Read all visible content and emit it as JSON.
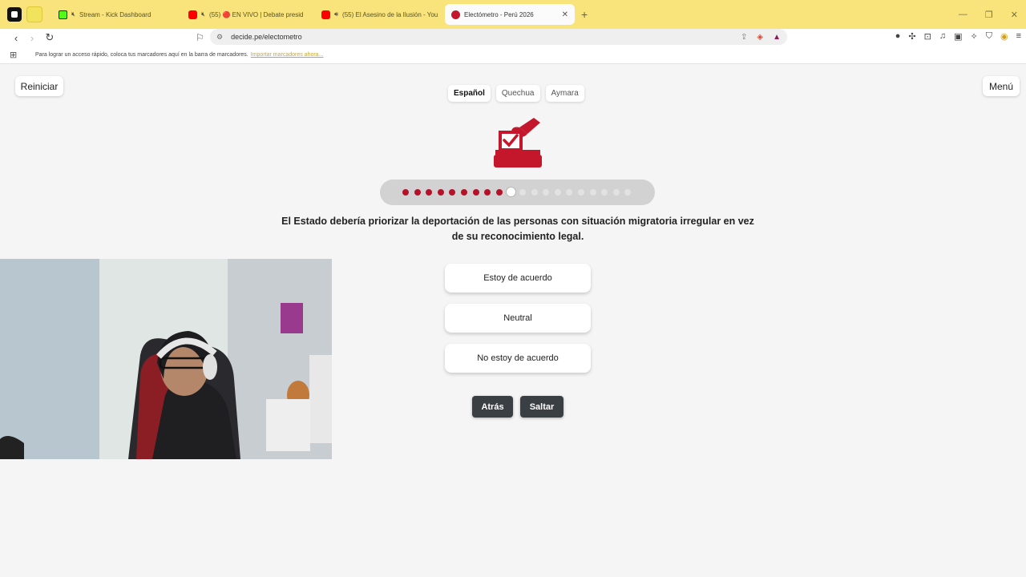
{
  "browser": {
    "tabs": [
      {
        "title": "Stream - Kick Dashboard",
        "icon": "kick-icon"
      },
      {
        "title": "(55) 🔴 EN VIVO | Debate presid",
        "icon": "youtube-icon"
      },
      {
        "title": "(55) El Asesino de la Ilusión - You",
        "icon": "youtube-icon"
      },
      {
        "title": "Electómetro - Perú 2026",
        "icon": "electometro-icon",
        "active": true
      }
    ],
    "new_tab_label": "+",
    "url": "decide.pe/electometro",
    "bookmarks_hint": "Para lograr un acceso rápido, coloca tus marcadores aquí en la barra de marcadores.",
    "bookmarks_import": "Importar marcadores ahora..."
  },
  "page": {
    "restart_label": "Reiniciar",
    "menu_label": "Menú",
    "languages": [
      "Español",
      "Quechua",
      "Aymara"
    ],
    "selected_language": "Español",
    "progress": {
      "answered": 9,
      "current": 10,
      "total": 20
    },
    "question": "El Estado debería priorizar la deportación de las personas con situación migratoria irregular en vez de su reconocimiento legal.",
    "answers": [
      "Estoy de acuerdo",
      "Neutral",
      "No estoy de acuerdo"
    ],
    "back_label": "Atrás",
    "skip_label": "Saltar"
  },
  "colors": {
    "accent": "#b5122a",
    "tabbar": "#f9e47c",
    "dark_button": "#3a3f44"
  }
}
